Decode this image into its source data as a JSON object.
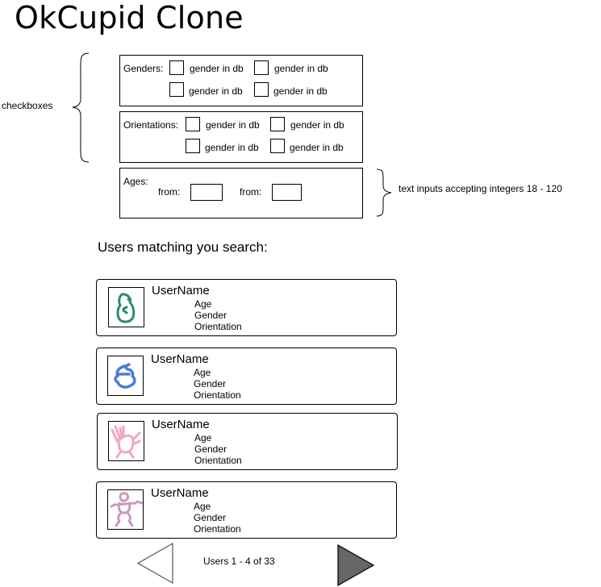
{
  "app": {
    "title": "OkCupid Clone"
  },
  "annotations": {
    "checkboxes": "checkboxes",
    "text_inputs": "text inputs accepting integers 18 - 120"
  },
  "filters": {
    "genders": {
      "label": "Genders:",
      "options": [
        "gender in db",
        "gender in db",
        "gender in db",
        "gender in db"
      ]
    },
    "orientations": {
      "label": "Orientations:",
      "options": [
        "gender in db",
        "gender in db",
        "gender in db",
        "gender in db"
      ]
    },
    "ages": {
      "label": "Ages:",
      "from_label_1": "from:",
      "from_label_2": "from:",
      "from_value": "",
      "to_value": ""
    }
  },
  "results": {
    "heading": "Users matching you search:",
    "users": [
      {
        "name": "UserName",
        "age": "Age",
        "gender": "Gender",
        "orientation": "Orientation",
        "avatar_color": "#2e8b6a"
      },
      {
        "name": "UserName",
        "age": "Age",
        "gender": "Gender",
        "orientation": "Orientation",
        "avatar_color": "#4a7fd4"
      },
      {
        "name": "UserName",
        "age": "Age",
        "gender": "Gender",
        "orientation": "Orientation",
        "avatar_color": "#f0a8c0"
      },
      {
        "name": "UserName",
        "age": "Age",
        "gender": "Gender",
        "orientation": "Orientation",
        "avatar_color": "#c99ac0"
      }
    ]
  },
  "pagination": {
    "status": "Users 1 - 4 of 33",
    "prev_icon": "triangle-left-outline",
    "next_icon": "triangle-right-filled"
  }
}
